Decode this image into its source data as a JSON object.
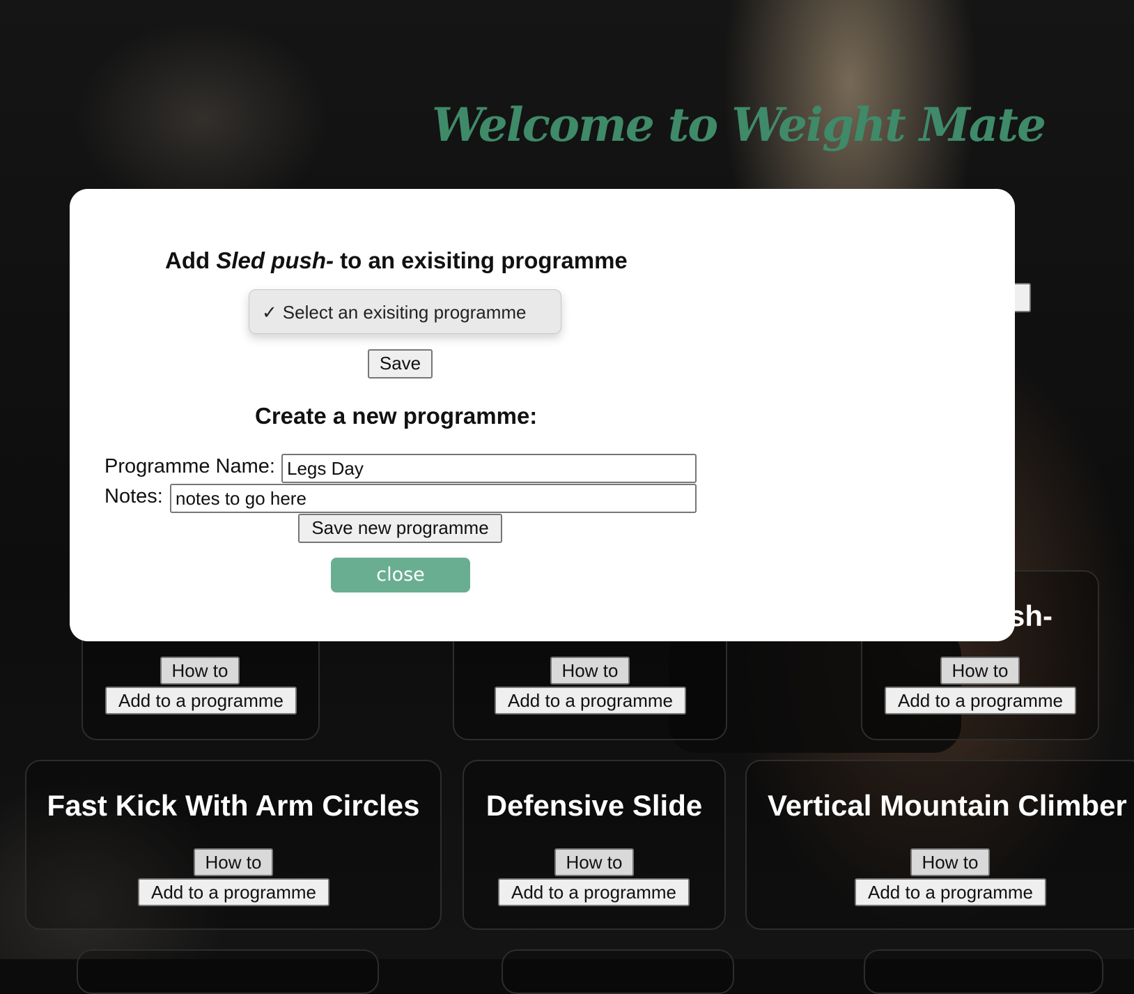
{
  "header": {
    "title": "Welcome to Weight Mate"
  },
  "modal": {
    "title_prefix": "Add ",
    "title_exercise": "Sled push-",
    "title_suffix": " to an exisiting programme",
    "select_check": "✓",
    "select_value": "Select an exisiting programme",
    "save_label": "Save",
    "create_heading": "Create a new programme:",
    "name_label": "Programme Name:",
    "name_value": "Legs Day",
    "notes_label": "Notes:",
    "notes_value": "notes to go here",
    "save_new_label": "Save new programme",
    "close_label": "close"
  },
  "cards": {
    "row1": {
      "partial_title": "sh-",
      "howto_label": "How to",
      "add_label": "Add to a programme"
    },
    "row2": [
      {
        "title": "Fast Kick With Arm Circles",
        "howto_label": "How to",
        "add_label": "Add to a programme"
      },
      {
        "title": "Defensive Slide",
        "howto_label": "How to",
        "add_label": "Add to a programme"
      },
      {
        "title": "Vertical Mountain Climber",
        "howto_label": "How to",
        "add_label": "Add to a programme"
      }
    ]
  },
  "colors": {
    "accent": "#3f8a69",
    "close_button": "#6aae92"
  }
}
